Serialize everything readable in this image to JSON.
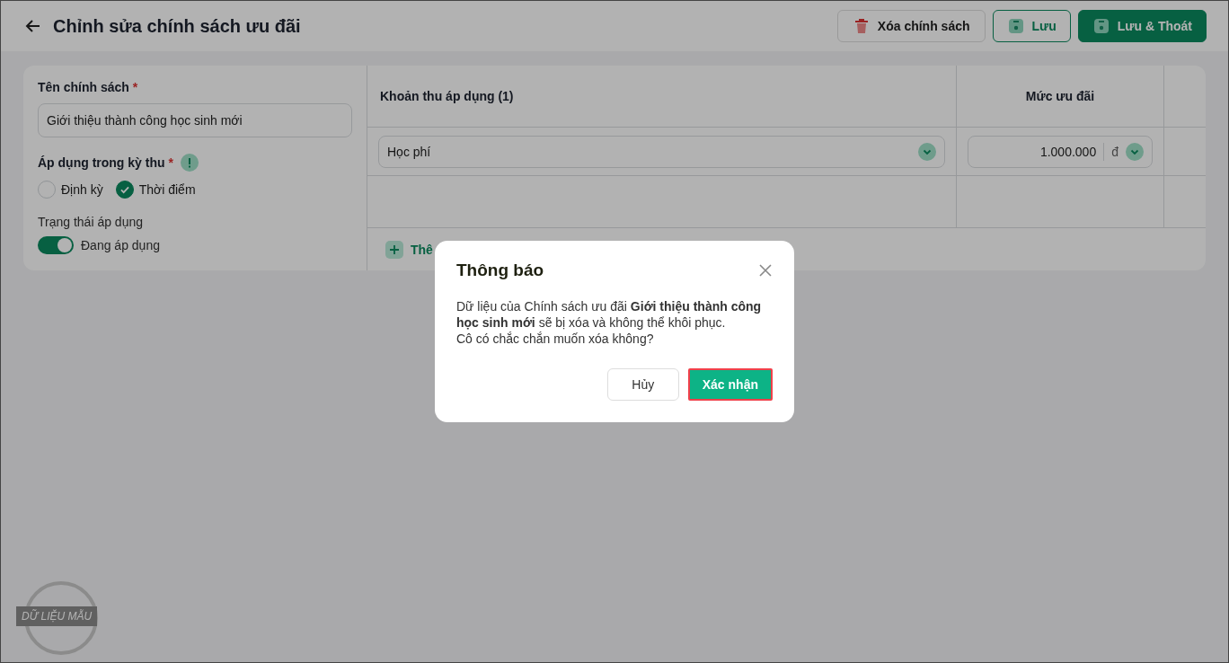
{
  "header": {
    "title": "Chỉnh sửa chính sách ưu đãi",
    "buttons": [
      {
        "label": "Xóa chính sách",
        "kind": "delete"
      },
      {
        "label": "Lưu",
        "kind": "save"
      },
      {
        "label": "Lưu & Thoát",
        "kind": "save_exit"
      }
    ]
  },
  "form": {
    "required_mark": "*",
    "name_label": "Tên chính sách",
    "name_value": "Giới thiệu thành công học sinh mới",
    "period_label": "Áp dụng trong kỳ thu",
    "period_options": [
      {
        "label": "Định kỳ",
        "selected": false
      },
      {
        "label": "Thời điểm",
        "selected": true
      }
    ],
    "status_label": "Trạng thái áp dụng",
    "status_toggle": {
      "on": true,
      "label": "Đang áp dụng"
    }
  },
  "table": {
    "columns": [
      "Khoản thu áp dụng (1)",
      "Mức ưu đãi"
    ],
    "rows": [
      {
        "fee": "Học phí",
        "amount": "1.000.000",
        "currency": "đ"
      }
    ],
    "add_label": "Thê"
  },
  "dialog": {
    "title": "Thông báo",
    "message": "Dữ liệu của Chính sách ưu đãi **Giới thiệu thành công học sinh mới** sẽ bị xóa và không thể khôi phục.",
    "question": "Cô có chắc chắn muốn xóa không?",
    "cancel": "Hủy",
    "confirm": "Xác nhận"
  },
  "stamp": {
    "text": "DỮ LIỆU MẪU"
  }
}
